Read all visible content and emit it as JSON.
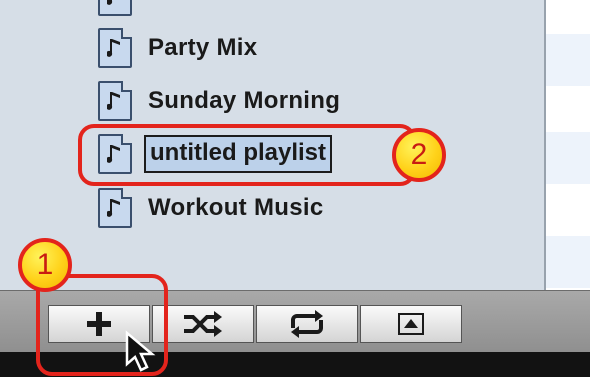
{
  "sidebar": {
    "playlists": [
      {
        "label": "Party Mix"
      },
      {
        "label": "Sunday Morning"
      },
      {
        "label": "untitled playlist",
        "editing": true
      },
      {
        "label": "Workout Music"
      }
    ]
  },
  "annotations": {
    "step1": "1",
    "step2": "2"
  },
  "toolbar": {
    "buttons": [
      {
        "name": "add-playlist-button",
        "icon": "plus-icon"
      },
      {
        "name": "shuffle-button",
        "icon": "shuffle-icon"
      },
      {
        "name": "repeat-button",
        "icon": "repeat-icon"
      },
      {
        "name": "show-artwork-button",
        "icon": "eject-icon"
      }
    ]
  },
  "colors": {
    "annotation_red": "#e3241c",
    "badge_yellow": "#ffd21a",
    "selection": "#bcd1ea"
  }
}
